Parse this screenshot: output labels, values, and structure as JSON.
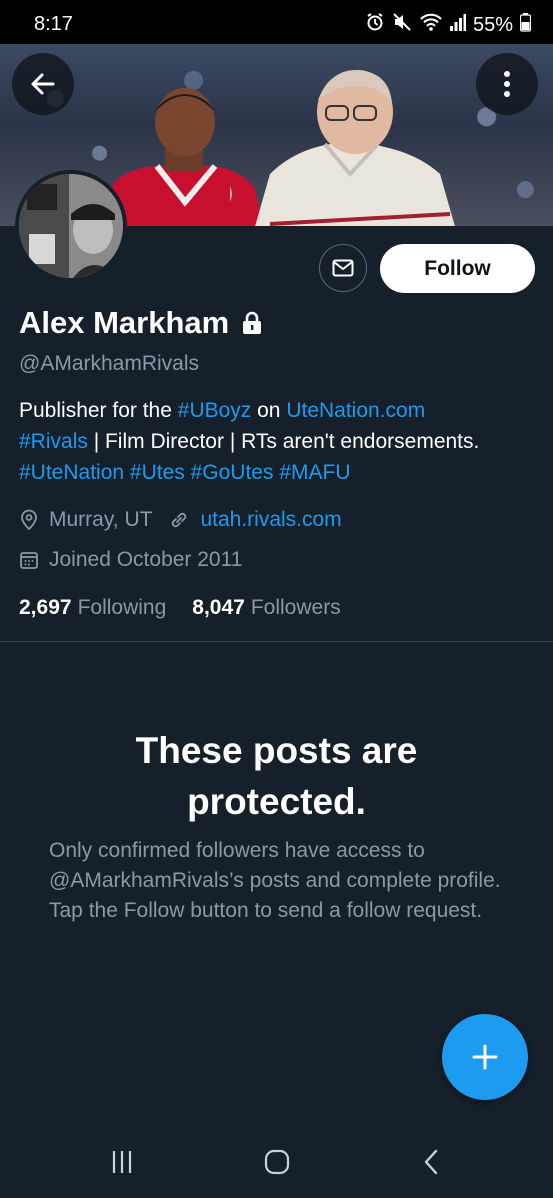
{
  "status_bar": {
    "time": "8:17",
    "battery": "55%",
    "icons": [
      "alarm-icon",
      "mute-icon",
      "wifi-icon",
      "signal-icon",
      "battery-icon"
    ]
  },
  "header": {
    "back_icon": "arrow-left-icon",
    "more_icon": "more-vertical-icon"
  },
  "profile": {
    "name": "Alex Markham",
    "lock_icon": "lock-icon",
    "handle": "@AMarkhamRivals",
    "bio": {
      "t1": "Publisher for the ",
      "tag_uboyz": "#UBoyz",
      "t2": " on ",
      "link_utenation": "UteNation.com",
      "tag_rivals": "#Rivals",
      "t3": " | Film Director | RTs aren't endorsements.",
      "tag_utenation": "#UteNation",
      "tag_utes": "#Utes",
      "tag_goutes": "#GoUtes",
      "tag_mafu": "#MAFU"
    },
    "location": "Murray, UT",
    "website": "utah.rivals.com",
    "joined": "Joined October 2011",
    "following_count": "2,697",
    "following_label": "Following",
    "followers_count": "8,047",
    "followers_label": "Followers"
  },
  "actions": {
    "message_icon": "envelope-icon",
    "follow_label": "Follow"
  },
  "protected": {
    "title_line1": "These posts are",
    "title_line2": "protected.",
    "body": "Only confirmed followers have access to @AMarkhamRivals’s posts and complete profile. Tap the Follow button to send a follow request."
  },
  "fab": {
    "icon": "plus-icon"
  },
  "nav_bar": {
    "icons": [
      "recents-icon",
      "home-icon",
      "back-icon"
    ]
  },
  "colors": {
    "background": "#15202b",
    "accent": "#1d9bf0",
    "muted": "#8b98a5"
  }
}
